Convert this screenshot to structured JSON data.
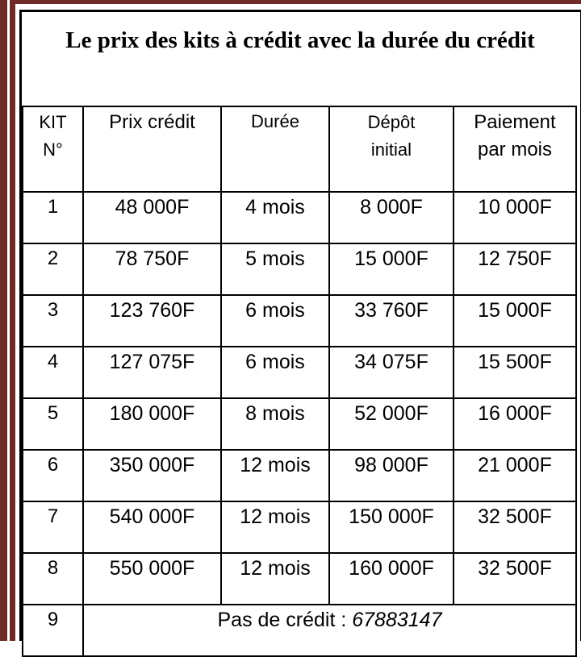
{
  "title": "Le prix des kits à crédit avec la durée du crédit",
  "headers": {
    "kit": "KIT N°",
    "prix": "Prix crédit",
    "duree": "Durée",
    "depot": "Dépôt initial",
    "paiement": "Paiement par mois"
  },
  "rows": [
    {
      "kit": "1",
      "prix": "48 000F",
      "duree": "4 mois",
      "depot": "8 000F",
      "paiement": "10 000F"
    },
    {
      "kit": "2",
      "prix": "78 750F",
      "duree": "5 mois",
      "depot": "15 000F",
      "paiement": "12 750F"
    },
    {
      "kit": "3",
      "prix": "123 760F",
      "duree": "6 mois",
      "depot": "33 760F",
      "paiement": "15 000F"
    },
    {
      "kit": "4",
      "prix": "127 075F",
      "duree": "6 mois",
      "depot": "34 075F",
      "paiement": "15 500F"
    },
    {
      "kit": "5",
      "prix": "180 000F",
      "duree": "8 mois",
      "depot": "52 000F",
      "paiement": "16 000F"
    },
    {
      "kit": "6",
      "prix": "350 000F",
      "duree": "12 mois",
      "depot": "98 000F",
      "paiement": "21 000F"
    },
    {
      "kit": "7",
      "prix": "540 000F",
      "duree": "12 mois",
      "depot": "150 000F",
      "paiement": "32 500F"
    },
    {
      "kit": "8",
      "prix": "550 000F",
      "duree": "12 mois",
      "depot": "160 000F",
      "paiement": "32 500F"
    }
  ],
  "last_row": {
    "kit": "9",
    "text": "Pas de crédit : ",
    "phone": "67883147"
  }
}
